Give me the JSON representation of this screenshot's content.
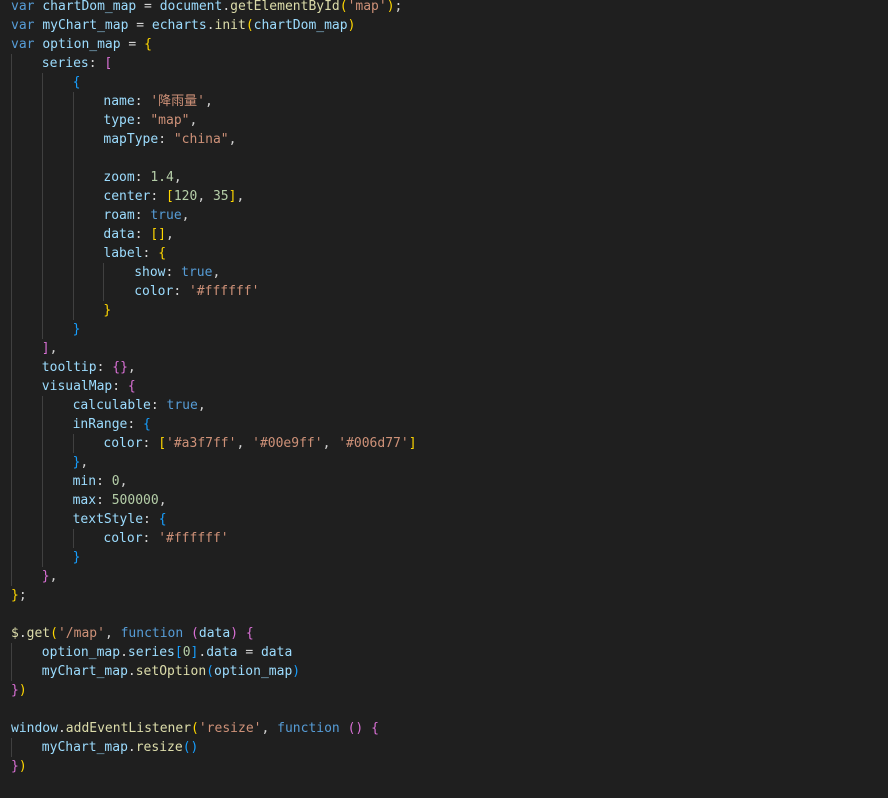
{
  "editor": {
    "language": "javascript",
    "theme_colors": {
      "background": "#1f1f1f",
      "keyword": "#569cd6",
      "variable": "#9cdcfe",
      "function": "#dcdcaa",
      "string": "#ce9178",
      "number": "#b5cea8",
      "bracket_level_1": "#ffd700",
      "bracket_level_2": "#da70d6",
      "bracket_level_3": "#179fff"
    },
    "lines": [
      {
        "indent": 0,
        "tokens": [
          [
            "keyword",
            "var"
          ],
          [
            "plain",
            " "
          ],
          [
            "var",
            "chartDom_map"
          ],
          [
            "plain",
            " = "
          ],
          [
            "var",
            "document"
          ],
          [
            "plain",
            "."
          ],
          [
            "func",
            "getElementById"
          ],
          [
            "b1",
            "("
          ],
          [
            "string",
            "'map'"
          ],
          [
            "b1",
            ")"
          ],
          [
            "plain",
            ";"
          ]
        ]
      },
      {
        "indent": 0,
        "tokens": [
          [
            "keyword",
            "var"
          ],
          [
            "plain",
            " "
          ],
          [
            "var",
            "myChart_map"
          ],
          [
            "plain",
            " = "
          ],
          [
            "var",
            "echarts"
          ],
          [
            "plain",
            "."
          ],
          [
            "func",
            "init"
          ],
          [
            "b1",
            "("
          ],
          [
            "var",
            "chartDom_map"
          ],
          [
            "b1",
            ")"
          ]
        ]
      },
      {
        "indent": 0,
        "tokens": [
          [
            "keyword",
            "var"
          ],
          [
            "plain",
            " "
          ],
          [
            "var",
            "option_map"
          ],
          [
            "plain",
            " = "
          ],
          [
            "b1",
            "{"
          ]
        ]
      },
      {
        "indent": 1,
        "tokens": [
          [
            "var",
            "series"
          ],
          [
            "plain",
            ": "
          ],
          [
            "b2",
            "["
          ]
        ]
      },
      {
        "indent": 2,
        "tokens": [
          [
            "b3",
            "{"
          ]
        ]
      },
      {
        "indent": 3,
        "tokens": [
          [
            "var",
            "name"
          ],
          [
            "plain",
            ": "
          ],
          [
            "string",
            "'降雨量'"
          ],
          [
            "plain",
            ","
          ]
        ]
      },
      {
        "indent": 3,
        "tokens": [
          [
            "var",
            "type"
          ],
          [
            "plain",
            ": "
          ],
          [
            "string",
            "\"map\""
          ],
          [
            "plain",
            ","
          ]
        ]
      },
      {
        "indent": 3,
        "tokens": [
          [
            "var",
            "mapType"
          ],
          [
            "plain",
            ": "
          ],
          [
            "string",
            "\"china\""
          ],
          [
            "plain",
            ","
          ]
        ]
      },
      {
        "indent": 3,
        "tokens": []
      },
      {
        "indent": 3,
        "tokens": [
          [
            "var",
            "zoom"
          ],
          [
            "plain",
            ": "
          ],
          [
            "number",
            "1.4"
          ],
          [
            "plain",
            ","
          ]
        ]
      },
      {
        "indent": 3,
        "tokens": [
          [
            "var",
            "center"
          ],
          [
            "plain",
            ": "
          ],
          [
            "b1",
            "["
          ],
          [
            "number",
            "120"
          ],
          [
            "plain",
            ", "
          ],
          [
            "number",
            "35"
          ],
          [
            "b1",
            "]"
          ],
          [
            "plain",
            ","
          ]
        ]
      },
      {
        "indent": 3,
        "tokens": [
          [
            "var",
            "roam"
          ],
          [
            "plain",
            ": "
          ],
          [
            "bool",
            "true"
          ],
          [
            "plain",
            ","
          ]
        ]
      },
      {
        "indent": 3,
        "tokens": [
          [
            "var",
            "data"
          ],
          [
            "plain",
            ": "
          ],
          [
            "b1",
            "[]"
          ],
          [
            "plain",
            ","
          ]
        ]
      },
      {
        "indent": 3,
        "tokens": [
          [
            "var",
            "label"
          ],
          [
            "plain",
            ": "
          ],
          [
            "b1",
            "{"
          ]
        ]
      },
      {
        "indent": 4,
        "tokens": [
          [
            "var",
            "show"
          ],
          [
            "plain",
            ": "
          ],
          [
            "bool",
            "true"
          ],
          [
            "plain",
            ","
          ]
        ]
      },
      {
        "indent": 4,
        "tokens": [
          [
            "var",
            "color"
          ],
          [
            "plain",
            ": "
          ],
          [
            "string",
            "'#ffffff'"
          ]
        ]
      },
      {
        "indent": 3,
        "tokens": [
          [
            "b1",
            "}"
          ]
        ]
      },
      {
        "indent": 2,
        "tokens": [
          [
            "b3",
            "}"
          ]
        ]
      },
      {
        "indent": 1,
        "tokens": [
          [
            "b2",
            "]"
          ],
          [
            "plain",
            ","
          ]
        ]
      },
      {
        "indent": 1,
        "tokens": [
          [
            "var",
            "tooltip"
          ],
          [
            "plain",
            ": "
          ],
          [
            "b2",
            "{}"
          ],
          [
            "plain",
            ","
          ]
        ]
      },
      {
        "indent": 1,
        "tokens": [
          [
            "var",
            "visualMap"
          ],
          [
            "plain",
            ": "
          ],
          [
            "b2",
            "{"
          ]
        ]
      },
      {
        "indent": 2,
        "tokens": [
          [
            "var",
            "calculable"
          ],
          [
            "plain",
            ": "
          ],
          [
            "bool",
            "true"
          ],
          [
            "plain",
            ","
          ]
        ]
      },
      {
        "indent": 2,
        "tokens": [
          [
            "var",
            "inRange"
          ],
          [
            "plain",
            ": "
          ],
          [
            "b3",
            "{"
          ]
        ]
      },
      {
        "indent": 3,
        "tokens": [
          [
            "var",
            "color"
          ],
          [
            "plain",
            ": "
          ],
          [
            "b1",
            "["
          ],
          [
            "string",
            "'#a3f7ff'"
          ],
          [
            "plain",
            ", "
          ],
          [
            "string",
            "'#00e9ff'"
          ],
          [
            "plain",
            ", "
          ],
          [
            "string",
            "'#006d77'"
          ],
          [
            "b1",
            "]"
          ]
        ]
      },
      {
        "indent": 2,
        "tokens": [
          [
            "b3",
            "}"
          ],
          [
            "plain",
            ","
          ]
        ]
      },
      {
        "indent": 2,
        "tokens": [
          [
            "var",
            "min"
          ],
          [
            "plain",
            ": "
          ],
          [
            "number",
            "0"
          ],
          [
            "plain",
            ","
          ]
        ]
      },
      {
        "indent": 2,
        "tokens": [
          [
            "var",
            "max"
          ],
          [
            "plain",
            ": "
          ],
          [
            "number",
            "500000"
          ],
          [
            "plain",
            ","
          ]
        ]
      },
      {
        "indent": 2,
        "tokens": [
          [
            "var",
            "textStyle"
          ],
          [
            "plain",
            ": "
          ],
          [
            "b3",
            "{"
          ]
        ]
      },
      {
        "indent": 3,
        "tokens": [
          [
            "var",
            "color"
          ],
          [
            "plain",
            ": "
          ],
          [
            "string",
            "'#ffffff'"
          ]
        ]
      },
      {
        "indent": 2,
        "tokens": [
          [
            "b3",
            "}"
          ]
        ]
      },
      {
        "indent": 1,
        "tokens": [
          [
            "b2",
            "}"
          ],
          [
            "plain",
            ","
          ]
        ]
      },
      {
        "indent": 0,
        "tokens": [
          [
            "b1",
            "}"
          ],
          [
            "plain",
            ";"
          ]
        ]
      },
      {
        "indent": 0,
        "tokens": []
      },
      {
        "indent": 0,
        "tokens": [
          [
            "func",
            "$"
          ],
          [
            "plain",
            "."
          ],
          [
            "func",
            "get"
          ],
          [
            "b1",
            "("
          ],
          [
            "string",
            "'/map'"
          ],
          [
            "plain",
            ", "
          ],
          [
            "keyword",
            "function"
          ],
          [
            "plain",
            " "
          ],
          [
            "b2",
            "("
          ],
          [
            "var",
            "data"
          ],
          [
            "b2",
            ")"
          ],
          [
            "plain",
            " "
          ],
          [
            "b2",
            "{"
          ]
        ]
      },
      {
        "indent": 1,
        "tokens": [
          [
            "var",
            "option_map"
          ],
          [
            "plain",
            "."
          ],
          [
            "var",
            "series"
          ],
          [
            "b3",
            "["
          ],
          [
            "number",
            "0"
          ],
          [
            "b3",
            "]"
          ],
          [
            "plain",
            "."
          ],
          [
            "var",
            "data"
          ],
          [
            "plain",
            " = "
          ],
          [
            "var",
            "data"
          ]
        ]
      },
      {
        "indent": 1,
        "tokens": [
          [
            "var",
            "myChart_map"
          ],
          [
            "plain",
            "."
          ],
          [
            "func",
            "setOption"
          ],
          [
            "b3",
            "("
          ],
          [
            "var",
            "option_map"
          ],
          [
            "b3",
            ")"
          ]
        ]
      },
      {
        "indent": 0,
        "tokens": [
          [
            "b2",
            "}"
          ],
          [
            "b1",
            ")"
          ]
        ]
      },
      {
        "indent": 0,
        "tokens": []
      },
      {
        "indent": 0,
        "tokens": [
          [
            "var",
            "window"
          ],
          [
            "plain",
            "."
          ],
          [
            "func",
            "addEventListener"
          ],
          [
            "b1",
            "("
          ],
          [
            "string",
            "'resize'"
          ],
          [
            "plain",
            ", "
          ],
          [
            "keyword",
            "function"
          ],
          [
            "plain",
            " "
          ],
          [
            "b2",
            "()"
          ],
          [
            "plain",
            " "
          ],
          [
            "b2",
            "{"
          ]
        ]
      },
      {
        "indent": 1,
        "tokens": [
          [
            "var",
            "myChart_map"
          ],
          [
            "plain",
            "."
          ],
          [
            "func",
            "resize"
          ],
          [
            "b3",
            "()"
          ]
        ]
      },
      {
        "indent": 0,
        "tokens": [
          [
            "b2",
            "}"
          ],
          [
            "b1",
            ")"
          ]
        ]
      }
    ]
  }
}
